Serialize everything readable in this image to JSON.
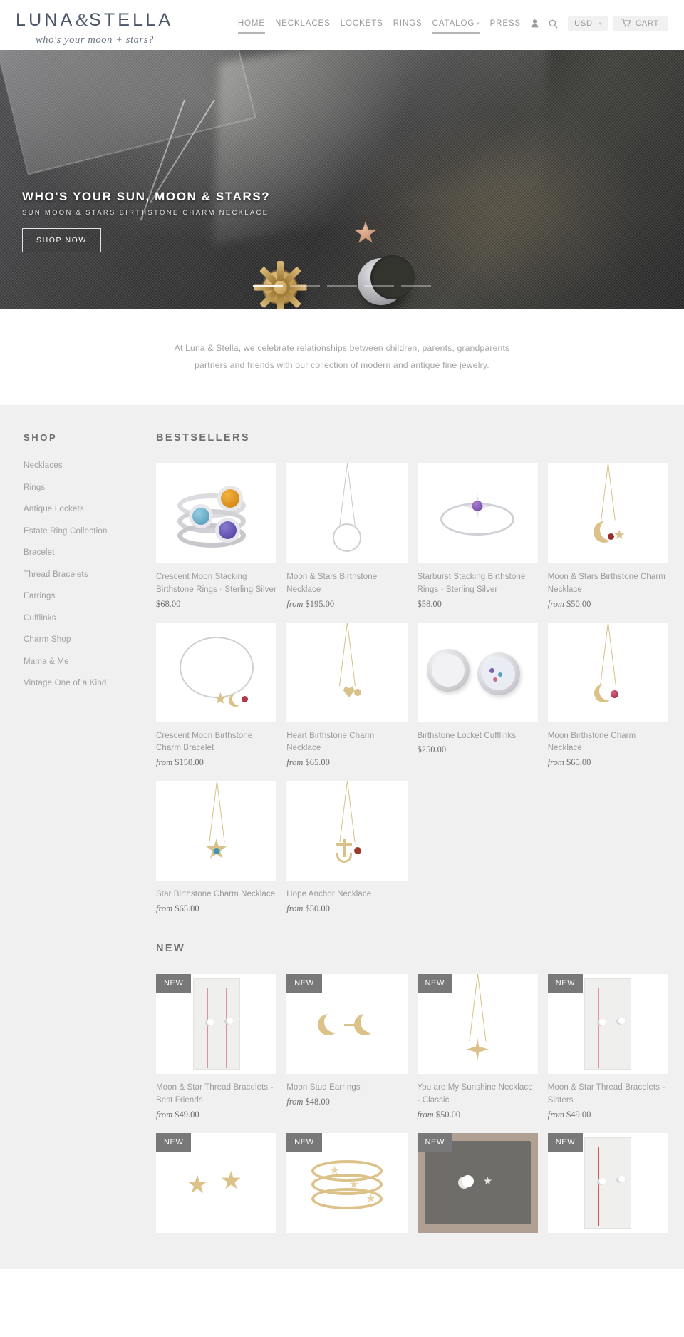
{
  "header": {
    "brand_line1_a": "LUNA",
    "brand_amp": "&",
    "brand_line1_b": "STELLA",
    "brand_tagline": "who's your moon + stars?",
    "nav": [
      {
        "label": "HOME",
        "active": true
      },
      {
        "label": "NECKLACES",
        "active": false
      },
      {
        "label": "LOCKETS",
        "active": false
      },
      {
        "label": "RINGS",
        "active": false
      },
      {
        "label": "CATALOG",
        "active": true,
        "caret": "▾"
      },
      {
        "label": "PRESS",
        "active": false
      }
    ],
    "account_icon": "user-icon",
    "search_icon": "search-icon",
    "currency_label": "USD",
    "currency_caret": "▾",
    "cart_label": "CART",
    "cart_icon": "shopping-cart-icon"
  },
  "hero": {
    "title": "WHO'S YOUR SUN, MOON & STARS?",
    "subtitle": "SUN MOON & STARS BIRTHSTONE CHARM NECKLACE",
    "button_label": "SHOP NOW",
    "slide_count": 5,
    "active_slide": 1
  },
  "intro": {
    "line1": "At Luna & Stella, we celebrate relationships between children, parents, grandparents",
    "line2": "partners and friends with our collection of modern and antique fine jewelry."
  },
  "sidebar": {
    "title": "SHOP",
    "items": [
      {
        "label": "Necklaces"
      },
      {
        "label": "Rings"
      },
      {
        "label": "Antique Lockets"
      },
      {
        "label": "Estate Ring Collection"
      },
      {
        "label": "Bracelet"
      },
      {
        "label": "Thread Bracelets"
      },
      {
        "label": "Earrings"
      },
      {
        "label": "Cufflinks"
      },
      {
        "label": "Charm Shop"
      },
      {
        "label": "Mama & Me"
      },
      {
        "label": "Vintage One of a Kind"
      }
    ]
  },
  "bestsellers": {
    "title": "BESTSELLERS",
    "products": [
      {
        "title": "Crescent Moon Stacking Birthstone Rings - Sterling Silver",
        "from": "",
        "price": "$68.00",
        "art": "stacking-rings-silver"
      },
      {
        "title": "Moon & Stars Birthstone Necklace",
        "from": "from ",
        "price": "$195.00",
        "art": "silver-circle-necklace"
      },
      {
        "title": "Starburst Stacking Birthstone Rings - Sterling Silver",
        "from": "",
        "price": "$58.00",
        "art": "starburst-ring-silver"
      },
      {
        "title": "Moon & Stars Birthstone Charm Necklace",
        "from": "from ",
        "price": "$50.00",
        "art": "moon-star-charm-necklace"
      },
      {
        "title": "Crescent Moon Birthstone Charm Bracelet",
        "from": "from ",
        "price": "$150.00",
        "art": "charm-bracelet"
      },
      {
        "title": "Heart Birthstone Charm Necklace",
        "from": "from ",
        "price": "$65.00",
        "art": "heart-charm-necklace"
      },
      {
        "title": "Birthstone Locket Cufflinks",
        "from": "",
        "price": "$250.00",
        "art": "locket-cufflinks"
      },
      {
        "title": "Moon Birthstone Charm Necklace",
        "from": "from ",
        "price": "$65.00",
        "art": "moon-charm-necklace"
      },
      {
        "title": "Star Birthstone Charm Necklace",
        "from": "from ",
        "price": "$65.00",
        "art": "star-charm-necklace"
      },
      {
        "title": "Hope Anchor Necklace",
        "from": "from ",
        "price": "$50.00",
        "art": "anchor-necklace"
      }
    ]
  },
  "new_section": {
    "title": "NEW",
    "badge_label": "NEW",
    "products": [
      {
        "title": "Moon & Star Thread Bracelets - Best Friends",
        "from": "from ",
        "price": "$49.00",
        "badge": true,
        "art": "thread-bracelet-card"
      },
      {
        "title": "Moon Stud Earrings",
        "from": "from ",
        "price": "$48.00",
        "badge": true,
        "art": "moon-studs"
      },
      {
        "title": "You are My Sunshine Necklace - Classic",
        "from": "from ",
        "price": "$50.00",
        "badge": true,
        "art": "sunshine-necklace"
      },
      {
        "title": "Moon & Star Thread Bracelets - Sisters",
        "from": "from ",
        "price": "$49.00",
        "badge": true,
        "art": "thread-bracelet-card"
      },
      {
        "title": "",
        "from": "",
        "price": "",
        "badge": true,
        "art": "star-studs"
      },
      {
        "title": "",
        "from": "",
        "price": "",
        "badge": true,
        "art": "stacking-rings-gold"
      },
      {
        "title": "",
        "from": "",
        "price": "",
        "badge": true,
        "art": "gray-pouch"
      },
      {
        "title": "",
        "from": "",
        "price": "",
        "badge": true,
        "art": "thread-bracelet-card"
      }
    ]
  },
  "colors": {
    "page_bg": "#f0f0f0",
    "card_bg": "#ffffff",
    "text_muted": "#9a9a9a",
    "heading": "#6f6f6f",
    "badge_bg": "#787878",
    "brand_navy": "#4a5568"
  }
}
